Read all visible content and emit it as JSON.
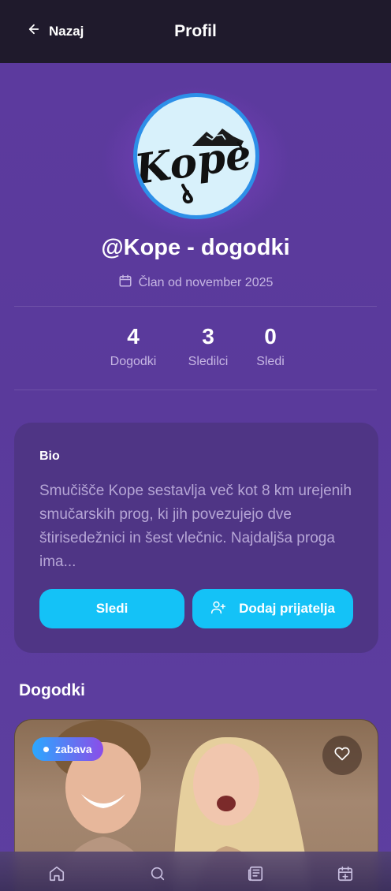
{
  "header": {
    "back_label": "Nazaj",
    "title": "Profil"
  },
  "profile": {
    "logo_text": "Kope",
    "handle": "@Kope - dogodki",
    "member_since": "Član od november 2025"
  },
  "stats": [
    {
      "value": "4",
      "label": "Dogodki"
    },
    {
      "value": "3",
      "label": "Sledilci"
    },
    {
      "value": "0",
      "label": "Sledi"
    }
  ],
  "bio": {
    "title": "Bio",
    "text": "Smučišče Kope sestavlja več kot 8 km urejenih smučarskih prog, ki jih povezujejo dve štirisedežnici in šest vlečnic. Najdaljša proga ima..."
  },
  "actions": {
    "follow_label": "Sledi",
    "add_friend_label": "Dodaj prijatelja"
  },
  "events_section": {
    "title": "Dogodki",
    "events": [
      {
        "category": "zabava",
        "favorite_icon": "heart-icon"
      }
    ]
  },
  "bottom_nav": {
    "items": [
      "home-icon",
      "search-icon",
      "news-icon",
      "calendar-add-icon"
    ]
  },
  "colors": {
    "accent": "#14c2f7",
    "background": "#5b3a9d",
    "header": "#1f1a2c",
    "card": "#4f3585"
  }
}
